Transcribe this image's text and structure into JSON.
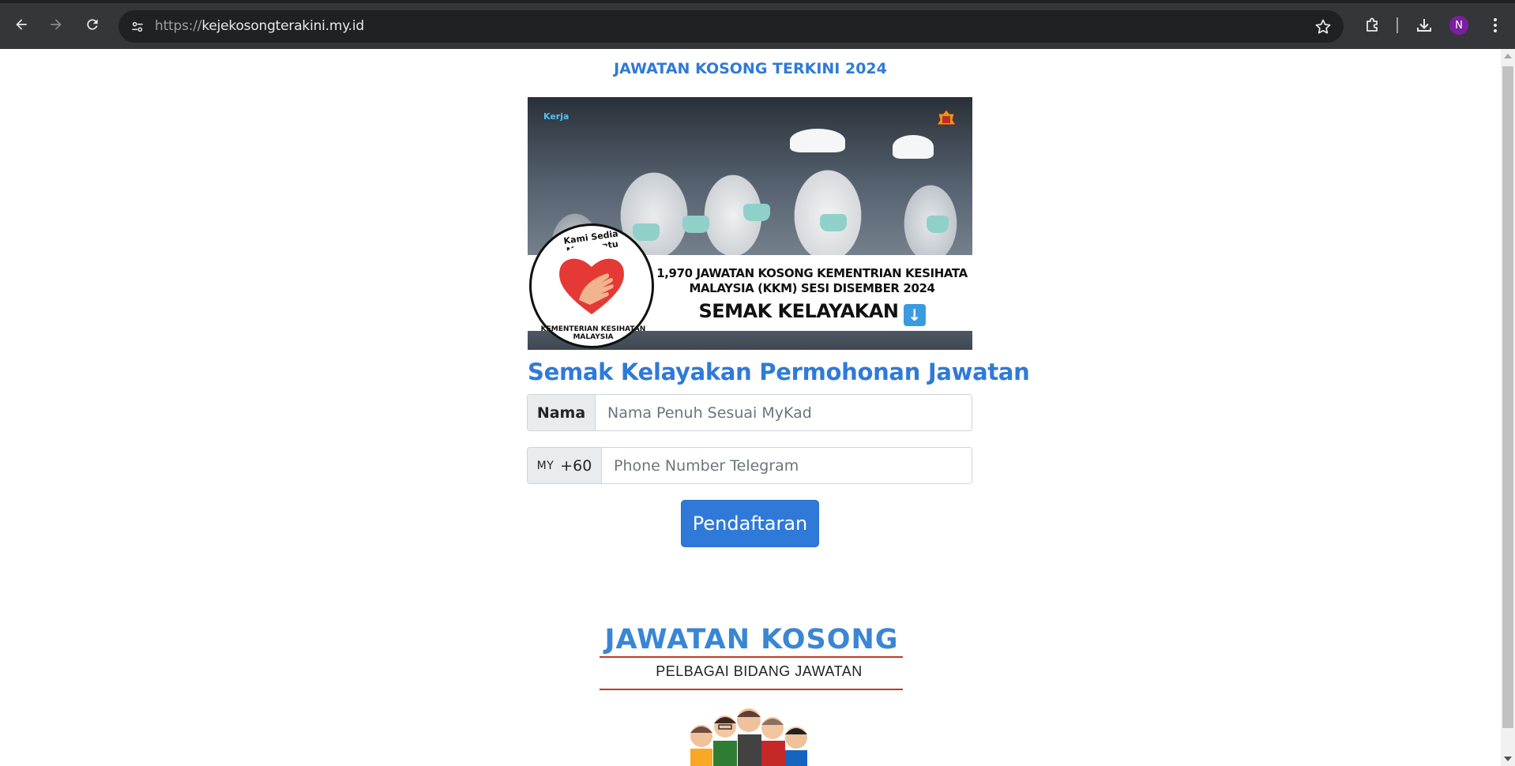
{
  "browser": {
    "url_scheme": "https://",
    "url_host": "kejekosongterakini.my.id",
    "profile_initial": "N",
    "icons": [
      "back-icon",
      "forward-icon",
      "reload-icon",
      "site-info-icon",
      "bookmark-star-icon",
      "extensions-icon",
      "download-icon",
      "more-menu-icon"
    ]
  },
  "page": {
    "site_title": "JAWATAN KOSONG TERKINI 2024",
    "banner": {
      "headline": "1,970 JAWATAN KOSONG KEMENTRIAN KESIHATA MALAYSIA (KKM) SESI DISEMBER 2024",
      "cta": "SEMAK KELAYAKAN",
      "seal_top": "Kami Sedia Membantu",
      "seal_bottom": "KEMENTERIAN KESIHATAN MALAYSIA",
      "brand_tag": "Kerja"
    },
    "form": {
      "title": "Semak Kelayakan Permohonan Jawatan",
      "name_label": "Nama",
      "name_placeholder": "Nama Penuh Sesuai MyKad",
      "phone_country": "MY",
      "phone_prefix": "+60",
      "phone_placeholder": "Phone Number Telegram",
      "submit_label": "Pendaftaran"
    },
    "promo": {
      "title": "JAWATAN KOSONG",
      "subtitle": "PELBAGAI BIDANG JAWATAN"
    }
  },
  "colors": {
    "accent": "#2f7ad8",
    "chrome": "#35363a",
    "avatar": "#7b1fa2"
  }
}
